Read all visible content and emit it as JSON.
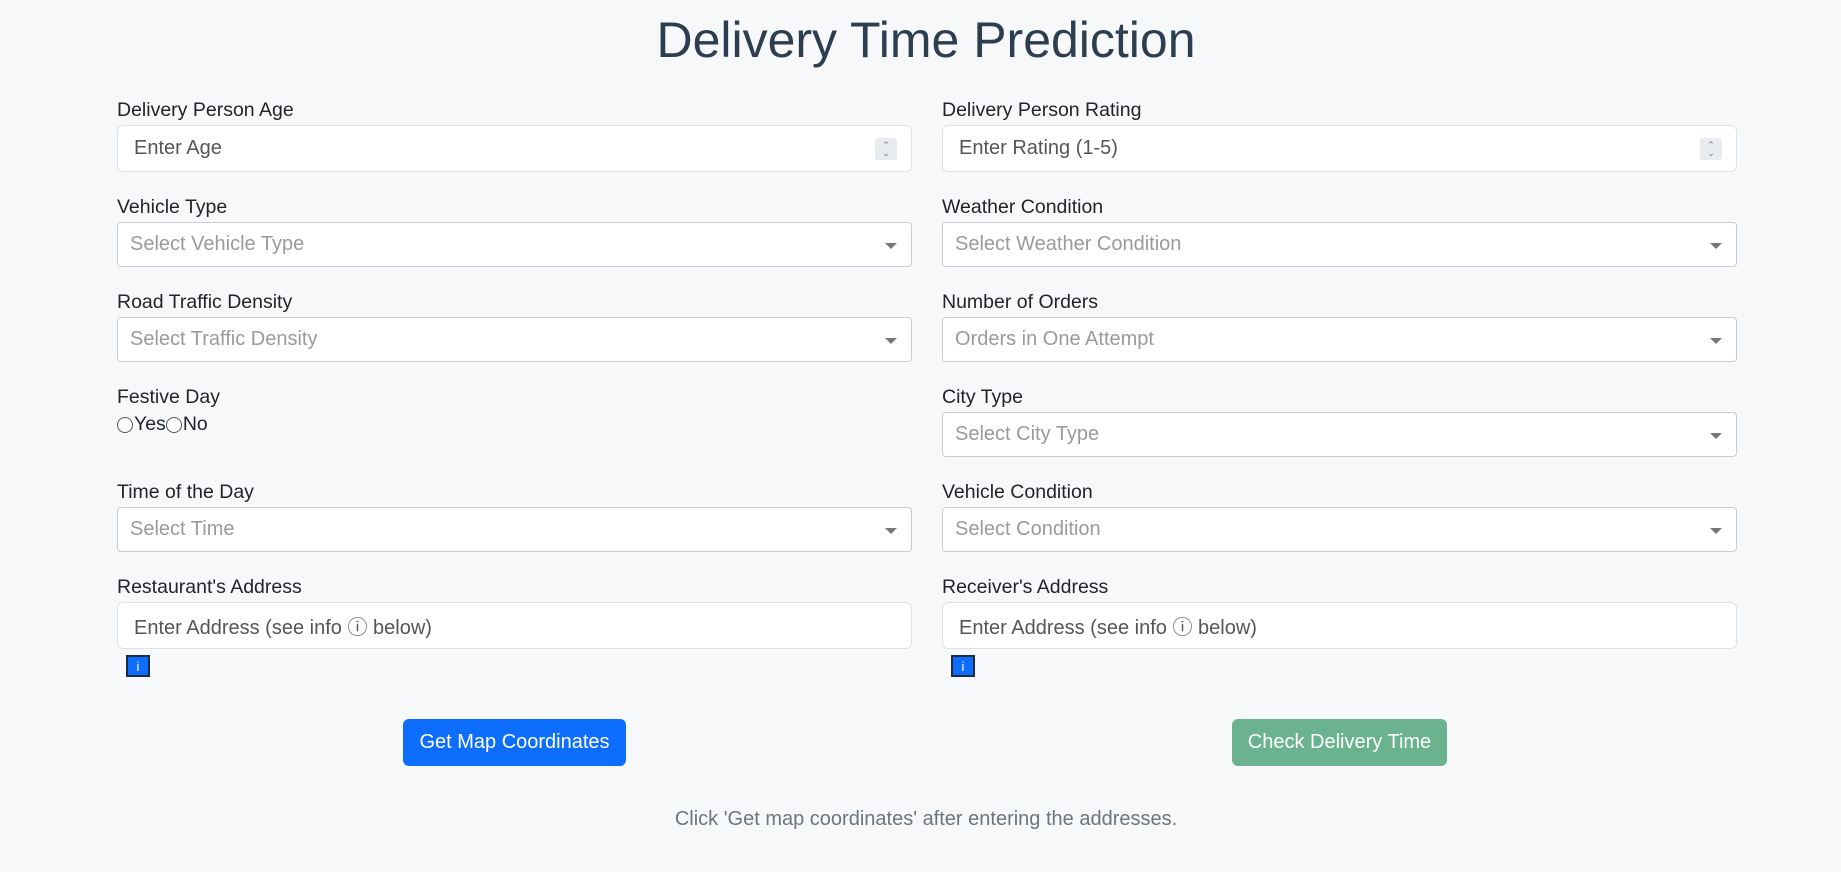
{
  "page": {
    "title": "Delivery Time Prediction",
    "helper_text": "Click 'Get map coordinates' after entering the addresses."
  },
  "fields": {
    "age": {
      "label": "Delivery Person Age",
      "placeholder": "Enter Age"
    },
    "rating": {
      "label": "Delivery Person Rating",
      "placeholder": "Enter Rating (1-5)"
    },
    "vehicle_type": {
      "label": "Vehicle Type",
      "placeholder": "Select Vehicle Type"
    },
    "weather": {
      "label": "Weather Condition",
      "placeholder": "Select Weather Condition"
    },
    "traffic": {
      "label": "Road Traffic Density",
      "placeholder": "Select Traffic Density"
    },
    "orders": {
      "label": "Number of Orders",
      "placeholder": "Orders in One Attempt"
    },
    "festive": {
      "label": "Festive Day",
      "options": [
        "Yes",
        "No"
      ]
    },
    "city": {
      "label": "City Type",
      "placeholder": "Select City Type"
    },
    "time": {
      "label": "Time of the Day",
      "placeholder": "Select Time"
    },
    "vehicle_condition": {
      "label": "Vehicle Condition",
      "placeholder": "Select Condition"
    },
    "restaurant_address": {
      "label": "Restaurant's Address",
      "placeholder": "Enter Address (see info ⓘ below)",
      "info_label": "i"
    },
    "receiver_address": {
      "label": "Receiver's Address",
      "placeholder": "Enter Address (see info ⓘ below)",
      "info_label": "i"
    }
  },
  "buttons": {
    "coordinates": "Get Map Coordinates",
    "check": "Check Delivery Time"
  },
  "colors": {
    "primary": "#0d6efd",
    "success": "#6bb38e",
    "title": "#2c3e50",
    "background": "#f7f8fa"
  }
}
